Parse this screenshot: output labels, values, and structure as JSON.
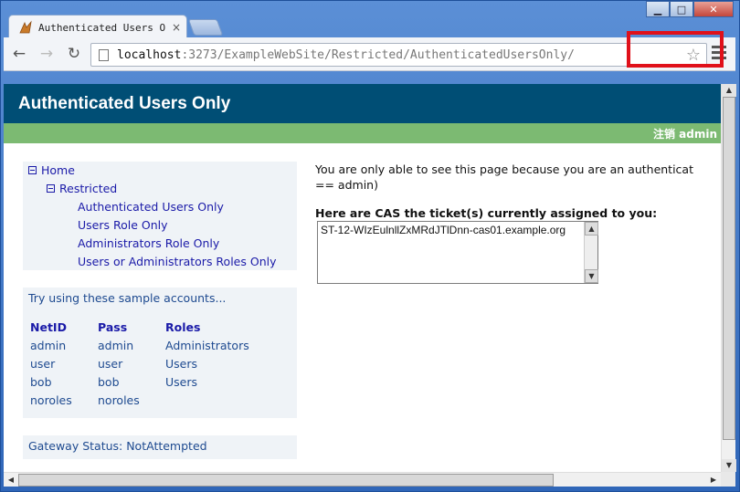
{
  "browser": {
    "tab_title": "Authenticated Users Onl",
    "tab_close": "×",
    "url_host": "localhost",
    "url_path": ":3273/ExampleWebSite/Restricted/AuthenticatedUsersOnly/",
    "window_min": "▁",
    "window_max": "□",
    "window_close": "✕",
    "back": "←",
    "forward": "→",
    "reload": "↻",
    "star": "☆"
  },
  "header": {
    "title": "Authenticated Users Only"
  },
  "greenbar": {
    "logout_label": "注销 admin"
  },
  "nav": {
    "home": "Home",
    "restricted": "Restricted",
    "items": [
      "Authenticated Users Only",
      "Users Role Only",
      "Administrators Role Only",
      "Users or Administrators Roles Only"
    ]
  },
  "accounts": {
    "intro": "Try using these sample accounts...",
    "headers": [
      "NetID",
      "Pass",
      "Roles"
    ],
    "rows": [
      [
        "admin",
        "admin",
        "Administrators"
      ],
      [
        "user",
        "user",
        "Users"
      ],
      [
        "bob",
        "bob",
        "Users"
      ],
      [
        "noroles",
        "noroles",
        ""
      ]
    ]
  },
  "gateway": {
    "status": "Gateway Status: NotAttempted"
  },
  "main": {
    "intro_line1": "You are only able to see this page because you are an authenticat",
    "intro_line2": "== admin)",
    "ticket_label": "Here are CAS the ticket(s) currently assigned to you:",
    "ticket_value": "ST-12-WIzEulnllZxMRdJTlDnn-cas01.example.org"
  },
  "colors": {
    "header_bg": "#004e75",
    "greenbar_bg": "#7cba72",
    "highlight": "#e0101a"
  }
}
